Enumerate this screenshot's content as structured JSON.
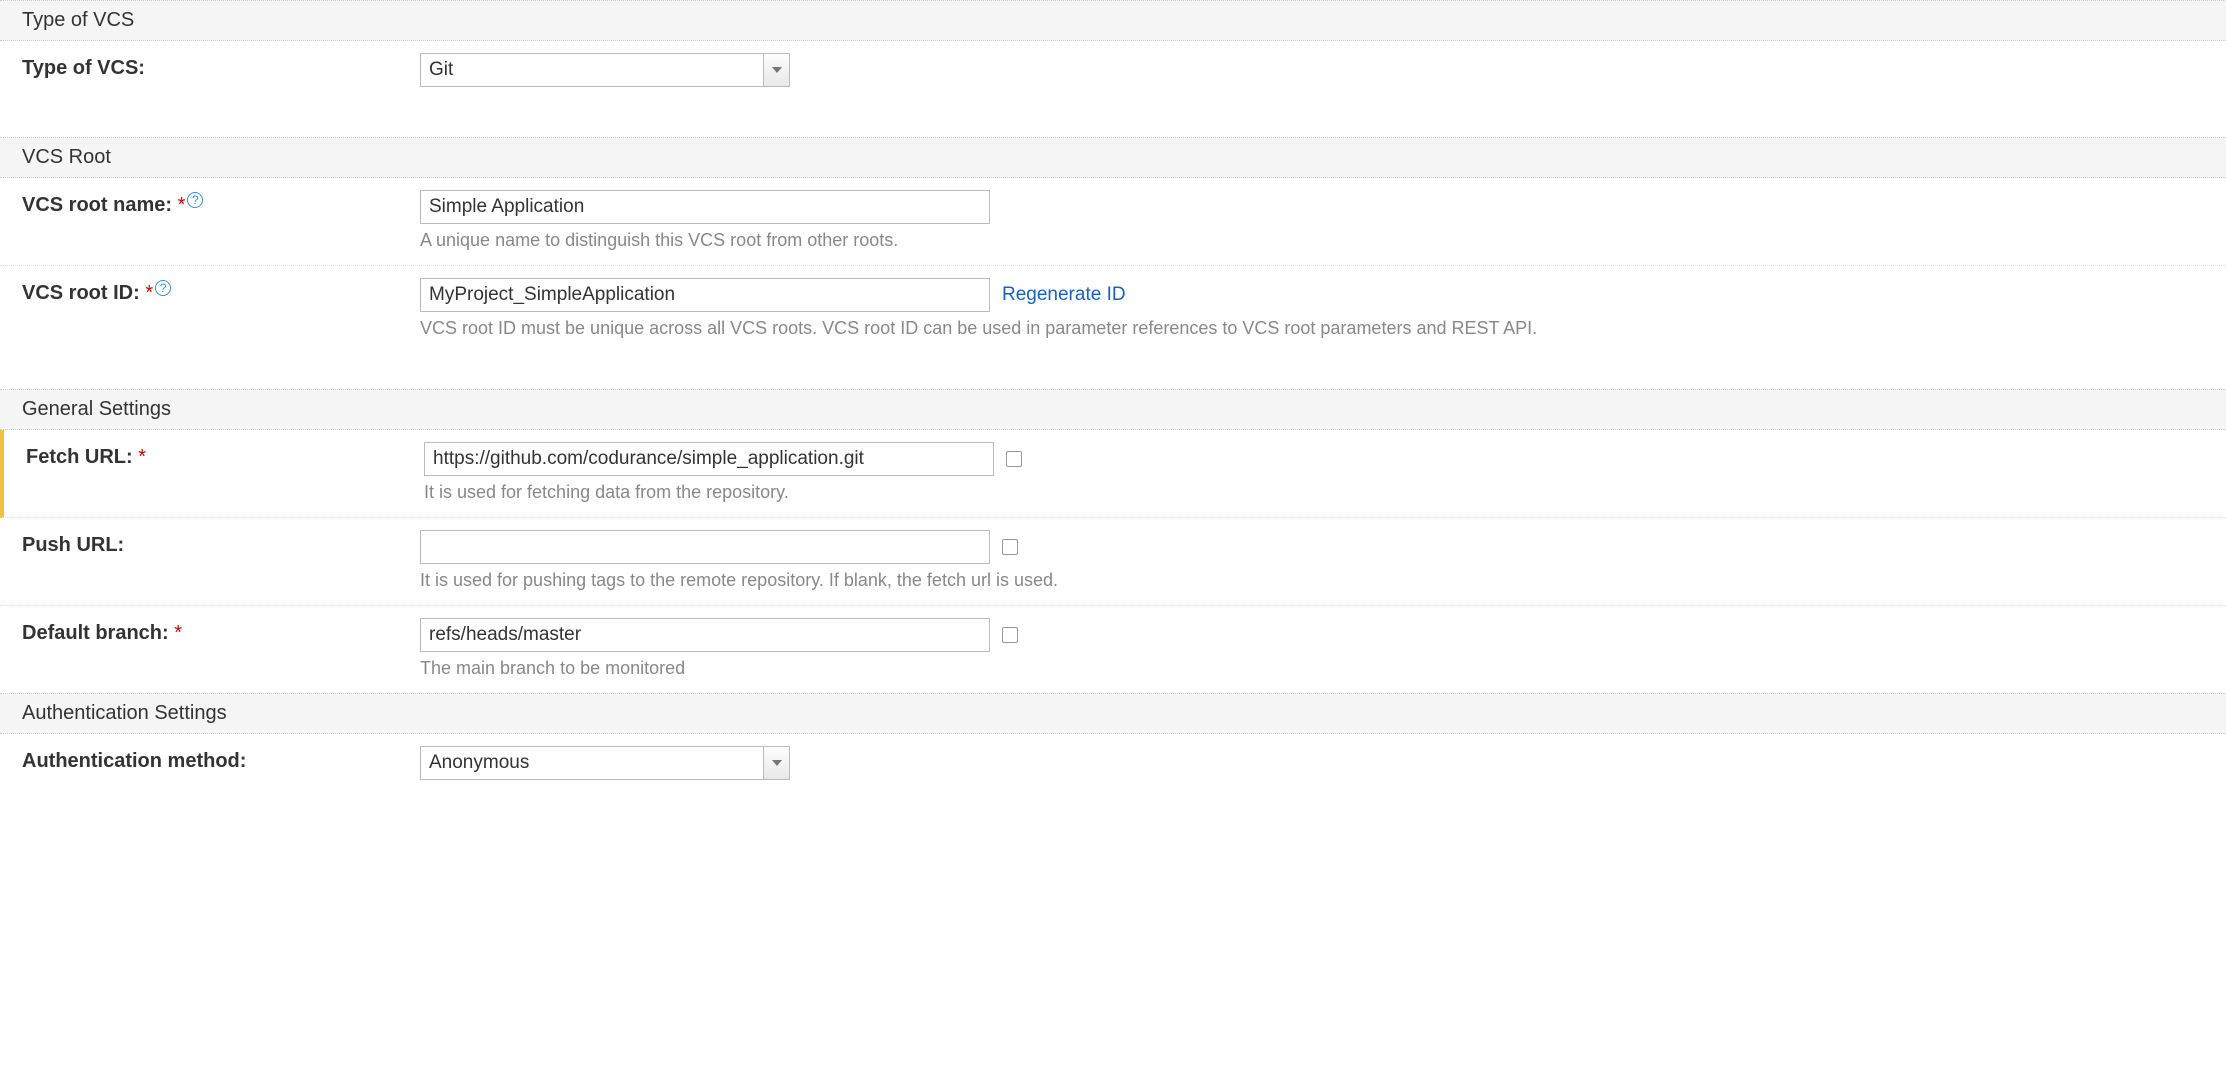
{
  "sections": {
    "type_of_vcs": "Type of VCS",
    "vcs_root": "VCS Root",
    "general": "General Settings",
    "auth": "Authentication Settings"
  },
  "type_of_vcs": {
    "label": "Type of VCS:",
    "value": "Git"
  },
  "vcs_root_name": {
    "label": "VCS root name:",
    "value": "Simple Application",
    "hint": "A unique name to distinguish this VCS root from other roots."
  },
  "vcs_root_id": {
    "label": "VCS root ID:",
    "value": "MyProject_SimpleApplication",
    "regen": "Regenerate ID",
    "hint": "VCS root ID must be unique across all VCS roots. VCS root ID can be used in parameter references to VCS root parameters and REST API."
  },
  "fetch_url": {
    "label": "Fetch URL:",
    "value": "https://github.com/codurance/simple_application.git",
    "hint": "It is used for fetching data from the repository."
  },
  "push_url": {
    "label": "Push URL:",
    "value": "",
    "hint": "It is used for pushing tags to the remote repository. If blank, the fetch url is used."
  },
  "default_branch": {
    "label": "Default branch:",
    "value": "refs/heads/master",
    "hint": "The main branch to be monitored"
  },
  "auth_method": {
    "label": "Authentication method:",
    "value": "Anonymous"
  }
}
